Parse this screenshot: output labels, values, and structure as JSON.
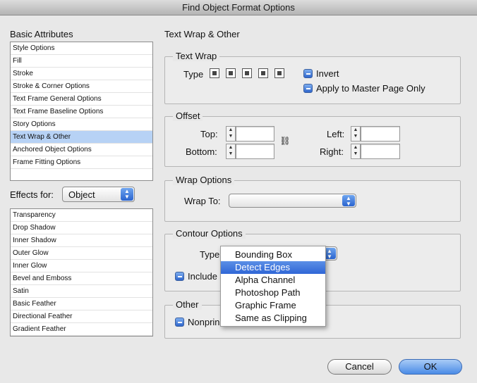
{
  "window": {
    "title": "Find Object Format Options"
  },
  "basic_attributes": {
    "heading": "Basic Attributes",
    "items": [
      "Style Options",
      "Fill",
      "Stroke",
      "Stroke & Corner Options",
      "Text Frame General Options",
      "Text Frame Baseline Options",
      "Story Options",
      "Text Wrap & Other",
      "Anchored Object Options",
      "Frame Fitting Options"
    ],
    "selected": "Text Wrap & Other"
  },
  "effects": {
    "label": "Effects for:",
    "value": "Object",
    "items": [
      "Transparency",
      "Drop Shadow",
      "Inner Shadow",
      "Outer Glow",
      "Inner Glow",
      "Bevel and Emboss",
      "Satin",
      "Basic Feather",
      "Directional Feather",
      "Gradient Feather"
    ]
  },
  "panel": {
    "title": "Text Wrap & Other"
  },
  "text_wrap": {
    "title": "Text Wrap",
    "type_label": "Type",
    "invert_label": "Invert",
    "apply_master_label": "Apply to Master Page Only"
  },
  "offset": {
    "title": "Offset",
    "top_label": "Top:",
    "bottom_label": "Bottom:",
    "left_label": "Left:",
    "right_label": "Right:",
    "top_value": "",
    "bottom_value": "",
    "left_value": "",
    "right_value": ""
  },
  "wrap_options": {
    "title": "Wrap Options",
    "wrap_to_label": "Wrap To:",
    "wrap_to_value": ""
  },
  "contour": {
    "title": "Contour Options",
    "type_label": "Type",
    "include_label": "Include",
    "menu_items": [
      "Bounding Box",
      "Detect Edges",
      "Alpha Channel",
      "Photoshop Path",
      "Graphic Frame",
      "Same as Clipping"
    ],
    "highlighted": "Detect Edges"
  },
  "other": {
    "title": "Other",
    "nonprint_label": "Nonprin"
  },
  "buttons": {
    "cancel": "Cancel",
    "ok": "OK"
  },
  "colors": {
    "accent": "#2f66d6",
    "selection": "#b7d2f5"
  }
}
